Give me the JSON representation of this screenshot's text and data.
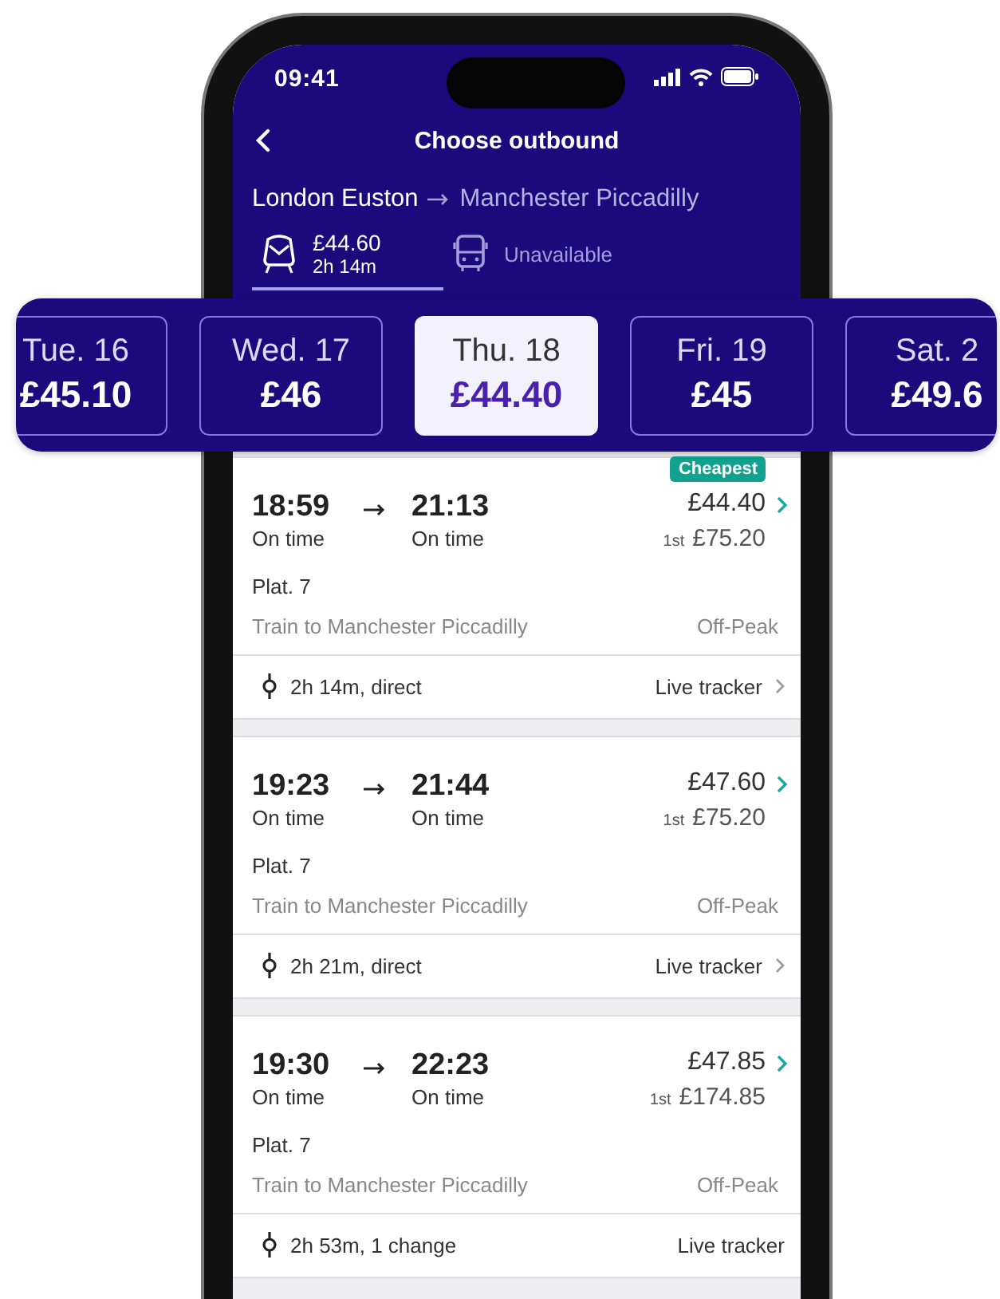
{
  "status_bar": {
    "time": "09:41"
  },
  "header": {
    "title": "Choose outbound"
  },
  "route": {
    "from": "London Euston",
    "to": "Manchester Piccadilly"
  },
  "modes": [
    {
      "kind": "train",
      "price": "£44.60",
      "duration": "2h 14m",
      "selected": true,
      "disabled": false
    },
    {
      "kind": "bus",
      "label": "Unavailable",
      "selected": false,
      "disabled": true
    }
  ],
  "dates": [
    {
      "day": "Tue. 16",
      "price": "£45.10",
      "selected": false
    },
    {
      "day": "Wed. 17",
      "price": "£46",
      "selected": false
    },
    {
      "day": "Thu. 18",
      "price": "£44.40",
      "selected": true
    },
    {
      "day": "Fri. 19",
      "price": "£45",
      "selected": false
    },
    {
      "day": "Sat. 2",
      "price": "£49.6",
      "selected": false
    }
  ],
  "journeys": [
    {
      "depart": "18:59",
      "arrive": "21:13",
      "depart_status": "On time",
      "arrive_status": "On time",
      "badge": "Cheapest",
      "price": "£44.40",
      "first_label": "1st",
      "first_price": "£75.20",
      "platform": "Plat. 7",
      "service": "Train to Manchester Piccadilly",
      "fare_type": "Off-Peak",
      "summary": "2h 14m, direct",
      "tracker": "Live tracker",
      "tracker_chevron": true
    },
    {
      "depart": "19:23",
      "arrive": "21:44",
      "depart_status": "On time",
      "arrive_status": "On time",
      "price": "£47.60",
      "first_label": "1st",
      "first_price": "£75.20",
      "platform": "Plat. 7",
      "service": "Train to Manchester Piccadilly",
      "fare_type": "Off-Peak",
      "summary": "2h 21m, direct",
      "tracker": "Live tracker",
      "tracker_chevron": true
    },
    {
      "depart": "19:30",
      "arrive": "22:23",
      "depart_status": "On time",
      "arrive_status": "On time",
      "price": "£47.85",
      "first_label": "1st",
      "first_price": "£174.85",
      "platform": "Plat. 7",
      "service": "Train to Manchester Piccadilly",
      "fare_type": "Off-Peak",
      "summary": "2h 53m, 1 change",
      "tracker": "Live tracker",
      "tracker_chevron": false
    }
  ]
}
